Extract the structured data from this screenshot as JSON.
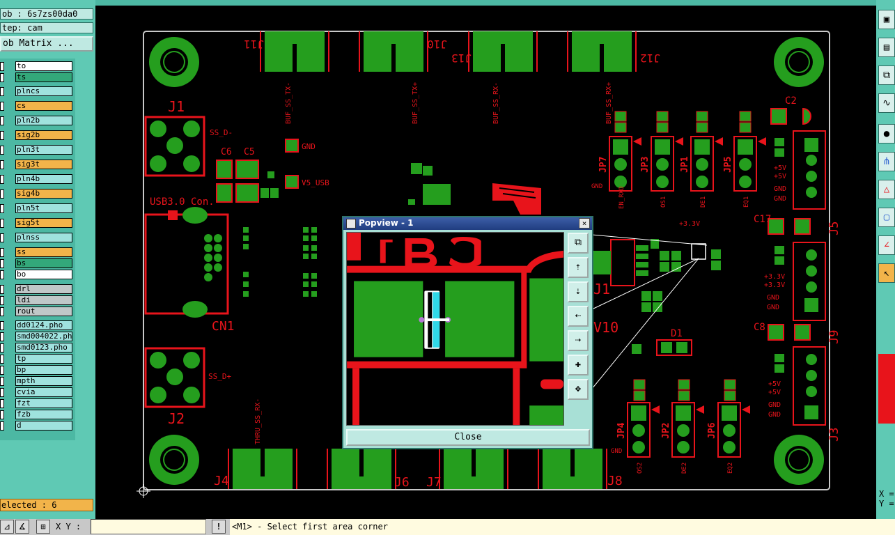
{
  "left_panel": {
    "job_label": "ob : 6s7zs00da0",
    "step_label": "tep: cam",
    "matrix_button": "ob Matrix ...",
    "layers": [
      {
        "name": "to",
        "color": "#ffffff"
      },
      {
        "name": "ts",
        "color": "#33a87a"
      },
      {
        "name": "plncs",
        "color": "#9fe2de"
      },
      {
        "name": "cs",
        "color": "#f2b44a"
      },
      {
        "name": "pln2b",
        "color": "#9fe2de"
      },
      {
        "name": "sig2b",
        "color": "#f2b44a"
      },
      {
        "name": "pln3t",
        "color": "#9fe2de"
      },
      {
        "name": "sig3t",
        "color": "#f2b44a"
      },
      {
        "name": "pln4b",
        "color": "#9fe2de"
      },
      {
        "name": "sig4b",
        "color": "#f2b44a"
      },
      {
        "name": "pln5t",
        "color": "#9fe2de"
      },
      {
        "name": "sig5t",
        "color": "#f2b44a"
      },
      {
        "name": "plnss",
        "color": "#9fe2de"
      },
      {
        "name": "ss",
        "color": "#f2b44a"
      },
      {
        "name": "bs",
        "color": "#33a87a"
      },
      {
        "name": "bo",
        "color": "#ffffff"
      },
      {
        "name": "drl",
        "color": "#c0c8c8"
      },
      {
        "name": "ldi",
        "color": "#c0c8c8"
      },
      {
        "name": "rout",
        "color": "#c0c8c8"
      },
      {
        "name": "dd0124.pho",
        "color": "#9fe2de"
      },
      {
        "name": "smd004022.ph",
        "color": "#9fe2de"
      },
      {
        "name": "smd0123.pho",
        "color": "#9fe2de"
      },
      {
        "name": "tp",
        "color": "#9fe2de"
      },
      {
        "name": "bp",
        "color": "#9fe2de"
      },
      {
        "name": "mpth",
        "color": "#9fe2de"
      },
      {
        "name": "cvia",
        "color": "#9fe2de"
      },
      {
        "name": "fzt",
        "color": "#9fe2de"
      },
      {
        "name": "fzb",
        "color": "#9fe2de"
      },
      {
        "name": "d",
        "color": "#9fe2de"
      }
    ],
    "selected_status": "elected : 6"
  },
  "bottom_bar": {
    "xy_label": "X Y :",
    "xy_value": "",
    "warning_icon": "exclamation-icon",
    "status_message": "<M1> - Select first area corner"
  },
  "right_coords": {
    "x_label": "X =",
    "y_label": "Y ="
  },
  "popup": {
    "title": "Popview - 1",
    "close_x": "×",
    "close_button": "Close"
  },
  "board_labels": {
    "connectors_top": [
      "J11",
      "J10",
      "J13",
      "J12"
    ],
    "connectors_bottom": [
      "J4",
      "J6",
      "J7",
      "J8"
    ],
    "j1": "J1",
    "j2": "J2",
    "cn1": "CN1",
    "usb": "USB3.0 Con.",
    "ss_d_minus": "SS_D-",
    "ss_d_plus": "SS_D+",
    "gnd": "GND",
    "v5usb": "V5_USB",
    "right_conns": [
      "J5",
      "J9",
      "J3"
    ],
    "jumpers_top": [
      "JP7",
      "JP3",
      "JP1",
      "JP5"
    ],
    "jumpers_bot": [
      "JP4",
      "JP2",
      "JP6"
    ],
    "caps": [
      "C6",
      "C5",
      "C2",
      "C17",
      "C8",
      "D1",
      "V10",
      "J1"
    ],
    "power_labels": [
      "+5V",
      "+5V",
      "GND",
      "GND",
      "+3.3V",
      "+3.3V",
      "GND",
      "GND",
      "+5V",
      "+5V",
      "GND",
      "GND"
    ]
  },
  "colors": {
    "panel": "#5fc9b4",
    "board_green": "#259e1e",
    "copper_red": "#e8141b",
    "popup_title": "#2a4a92"
  }
}
